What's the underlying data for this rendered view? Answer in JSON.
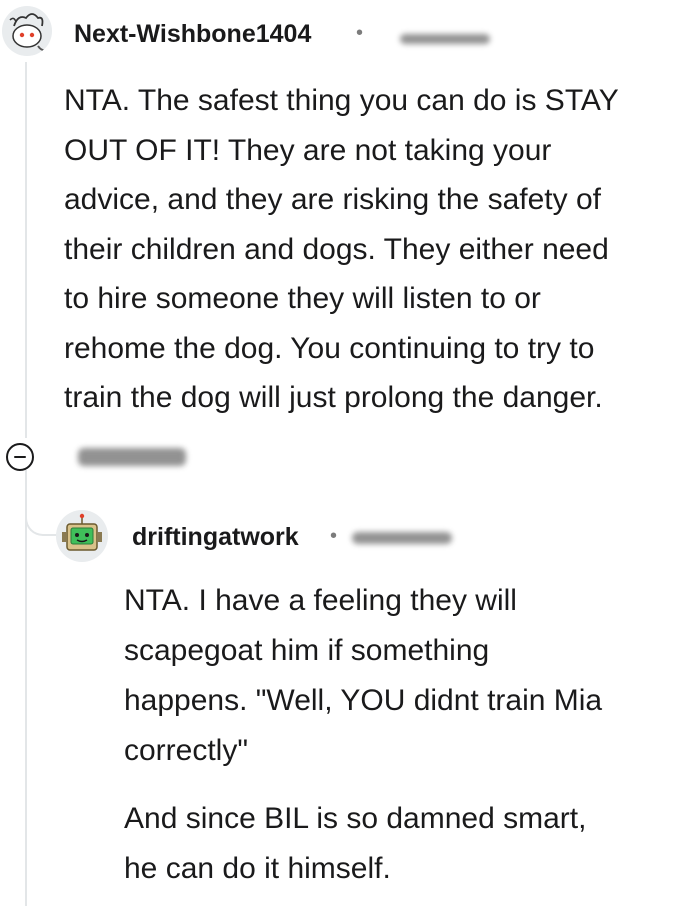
{
  "comment1": {
    "username": "Next-Wishbone1404",
    "separator": "•",
    "body": "NTA. The safest thing you can do is STAY\nOUT OF IT! They are not taking your\nadvice, and they are risking the safety of\ntheir children and dogs. They either need\nto hire someone they will listen to or\nrehome the dog. You continuing to try to\ntrain the dog will just prolong the danger."
  },
  "reply": {
    "username": "driftingatwork",
    "separator": "•",
    "body_paragraph_1": "NTA. I have a feeling they will\nscapegoat him if something\nhappens. \"Well, YOU didnt train Mia\ncorrectly\"",
    "body_paragraph_2": "And since BIL is so damned smart,\nhe can do it himself."
  },
  "colors": {
    "text": "#1a1a1b",
    "meta": "#7c7c7c",
    "thread_line": "#e3e6e8"
  },
  "icons": {
    "avatar_1": "snoo-avatar-icon",
    "avatar_2": "robot-avatar-icon",
    "collapse": "collapse-thread-icon"
  }
}
